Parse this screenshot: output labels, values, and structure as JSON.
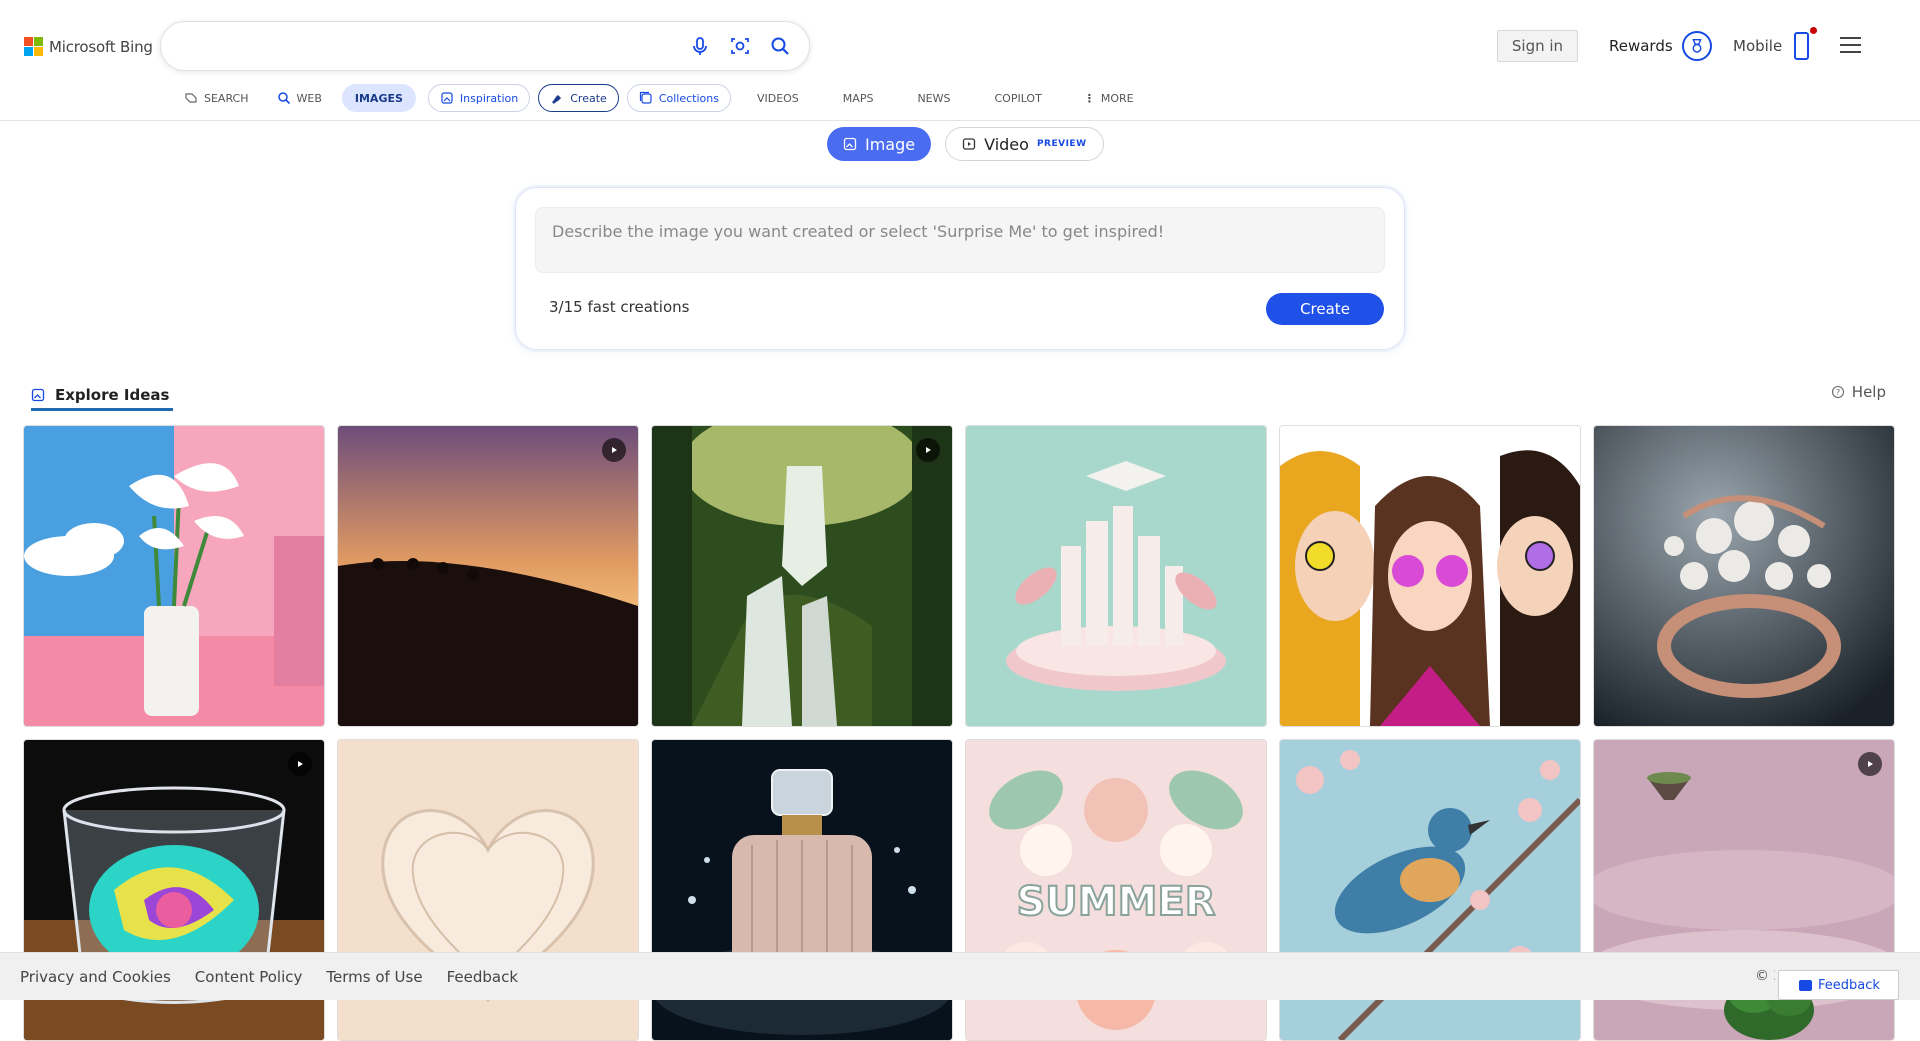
{
  "header": {
    "logo_text": "Microsoft Bing",
    "search_value": "",
    "signin_label": "Sign in",
    "rewards_label": "Rewards",
    "mobile_label": "Mobile"
  },
  "scopes": [
    {
      "label": "SEARCH",
      "icon": "copilot-icon"
    },
    {
      "label": "WEB",
      "icon": "search-icon"
    },
    {
      "label": "IMAGES",
      "icon": ""
    },
    {
      "label": "Inspiration",
      "icon": "inspiration-icon"
    },
    {
      "label": "Create",
      "icon": "create-icon"
    },
    {
      "label": "Collections",
      "icon": "collections-icon"
    },
    {
      "label": "VIDEOS",
      "icon": ""
    },
    {
      "label": "MAPS",
      "icon": ""
    },
    {
      "label": "NEWS",
      "icon": ""
    },
    {
      "label": "COPILOT",
      "icon": ""
    },
    {
      "label": "MORE",
      "icon": "more-vertical-icon"
    }
  ],
  "creator": {
    "mode_image": "Image",
    "mode_video": "Video",
    "video_badge": "PREVIEW",
    "prompt_placeholder": "Describe the image you want created or select 'Surprise Me' to get inspired!",
    "creations_text": "3/15 fast creations",
    "create_label": "Create"
  },
  "explore": {
    "tab_label": "Explore Ideas",
    "help_label": "Help",
    "tiles": [
      {
        "subject": "calla lilies in vase",
        "video": false
      },
      {
        "subject": "camel caravan at sunset",
        "video": true
      },
      {
        "subject": "forest waterfall",
        "video": true
      },
      {
        "subject": "graduation cap paper city",
        "video": false
      },
      {
        "subject": "anime trio with sunglasses",
        "video": false
      },
      {
        "subject": "pearl ring",
        "video": false
      },
      {
        "subject": "swirling glass cup",
        "video": true
      },
      {
        "subject": "paper heart",
        "video": false
      },
      {
        "subject": "perfume bottle splash",
        "video": false
      },
      {
        "subject": "summer paper flowers",
        "video": false
      },
      {
        "subject": "bird on blossom branch",
        "video": false
      },
      {
        "subject": "floating islands",
        "video": true
      }
    ]
  },
  "footer": {
    "links": [
      "Privacy and Cookies",
      "Content Policy",
      "Terms of Use",
      "Feedback"
    ],
    "copyright": "© 2",
    "feedback_button": "Feedback"
  },
  "colors": {
    "accent": "#174ae4",
    "create_button": "#1f50e8",
    "image_toggle": "#4a6cf0",
    "images_tab_bg": "#dbe5ff"
  }
}
